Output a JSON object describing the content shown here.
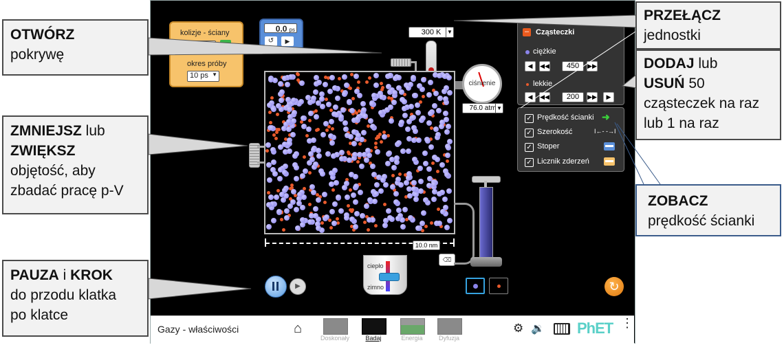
{
  "callouts": {
    "open_lid": {
      "bold": "OTWÓRZ",
      "rest": "pokrywę"
    },
    "volume": {
      "bold1": "ZMNIEJSZ",
      "mid": " lub",
      "bold2": "ZWIĘKSZ",
      "rest1": "objętość, aby",
      "rest2": "zbadać pracę p-V"
    },
    "pause": {
      "bold1": "PAUZA",
      "mid": " i ",
      "bold2": "KROK",
      "rest1": "do przodu klatka",
      "rest2": "po klatce"
    },
    "switch_units": {
      "bold": "PRZEŁĄCZ",
      "rest": "jednostki"
    },
    "add_remove": {
      "bold1": "DODAJ",
      "mid": " lub",
      "bold2": "USUŃ",
      "num": " 50",
      "rest1": "cząsteczek na raz",
      "rest2": "lub 1 na raz"
    },
    "see_speed": {
      "bold": "ZOBACZ",
      "rest": "prędkość ścianki"
    }
  },
  "collisions_panel": {
    "label": "kolizje - ściany",
    "period_label": "okres próby",
    "period_value": "10 ps"
  },
  "stopwatch": {
    "value": "0.0",
    "unit": "ps"
  },
  "thermometer": {
    "value": "300 K"
  },
  "pressure_gauge": {
    "label": "ciśnienie",
    "value": "76.0 atm"
  },
  "width_readout": "10.0 nm",
  "heat_cool": {
    "heat": "ciepło",
    "cool": "zimno"
  },
  "particles_panel": {
    "title": "Cząsteczki",
    "heavy": {
      "label": "ciężkie",
      "value": "450"
    },
    "light": {
      "label": "lekkie",
      "value": "200"
    }
  },
  "options_panel": [
    {
      "label": "Prędkość ścianki",
      "checked": true
    },
    {
      "label": "Szerokość",
      "checked": true
    },
    {
      "label": "Stoper",
      "checked": true
    },
    {
      "label": "Licznik zderzeń",
      "checked": true
    }
  ],
  "navbar": {
    "title": "Gazy - właściwości",
    "tabs": [
      "Doskonały",
      "Badaj",
      "Energia",
      "Dyfuzja"
    ],
    "brand": "PhET"
  },
  "colors": {
    "heavy": "#8b84ea",
    "light": "#e85a2c",
    "accent": "#f7c36b"
  }
}
